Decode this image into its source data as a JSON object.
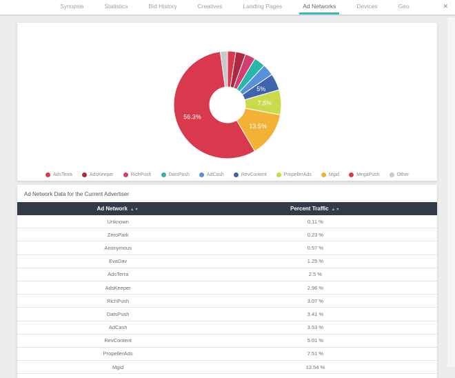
{
  "nav": {
    "tabs": [
      {
        "label": "Synopsis",
        "active": false
      },
      {
        "label": "Statistics",
        "active": false
      },
      {
        "label": "Bid History",
        "active": false
      },
      {
        "label": "Creatives",
        "active": false
      },
      {
        "label": "Landing Pages",
        "active": false
      },
      {
        "label": "Ad Networks",
        "active": true
      },
      {
        "label": "Devices",
        "active": false
      },
      {
        "label": "Geo",
        "active": false
      }
    ],
    "close_icon": "✕"
  },
  "colors": {
    "accent_teal": "#3ab7bc",
    "table_header_bg": "#323a45",
    "page_bg": "#ececec",
    "row_border": "#e3e3e3"
  },
  "chart_data": {
    "type": "pie",
    "subtype": "donut",
    "legend_position": "bottom",
    "inner_radius_ratio": 0.33,
    "series": [
      {
        "name": "AdsTerra",
        "value": 2.5,
        "color": "#d8394c",
        "label": ""
      },
      {
        "name": "AdsKeeper",
        "value": 2.96,
        "color": "#ae2840",
        "label": ""
      },
      {
        "name": "RichPush",
        "value": 3.07,
        "color": "#d23f6e",
        "label": ""
      },
      {
        "name": "DatsPush",
        "value": 3.41,
        "color": "#28b6ab",
        "label": ""
      },
      {
        "name": "AdCash",
        "value": 3.53,
        "color": "#5791d9",
        "label": ""
      },
      {
        "name": "RevContent",
        "value": 5.01,
        "color": "#3e64ad",
        "label": "5%"
      },
      {
        "name": "PropellerAds",
        "value": 7.51,
        "color": "#c9da4a",
        "label": "7.5%"
      },
      {
        "name": "Mgid",
        "value": 13.54,
        "color": "#f3b236",
        "label": "13.5%"
      },
      {
        "name": "MegaPush",
        "value": 56.31,
        "color": "#d8394c",
        "label": "56.3%"
      },
      {
        "name": "Other",
        "value": 2.16,
        "color": "#c9c9c9",
        "label": ""
      }
    ]
  },
  "table_section": {
    "title": "Ad Network Data for the Current Advertiser",
    "columns": [
      {
        "label": "Ad Network"
      },
      {
        "label": "Percent Traffic"
      }
    ],
    "sort_asc_icon": "▲",
    "sort_desc_icon": "▼",
    "rows": [
      {
        "network": "Unknown",
        "percent": "0.11 %"
      },
      {
        "network": "ZeroPark",
        "percent": "0.23 %"
      },
      {
        "network": "Anonymous",
        "percent": "0.57 %"
      },
      {
        "network": "EvaDav",
        "percent": "1.25 %"
      },
      {
        "network": "AdsTerra",
        "percent": "2.5 %"
      },
      {
        "network": "AdsKeeper",
        "percent": "2.96 %"
      },
      {
        "network": "RichPush",
        "percent": "3.07 %"
      },
      {
        "network": "DatsPush",
        "percent": "3.41 %"
      },
      {
        "network": "AdCash",
        "percent": "3.53 %"
      },
      {
        "network": "RevContent",
        "percent": "5.01 %"
      },
      {
        "network": "PropellerAds",
        "percent": "7.51 %"
      },
      {
        "network": "Mgid",
        "percent": "13.54 %"
      }
    ]
  }
}
